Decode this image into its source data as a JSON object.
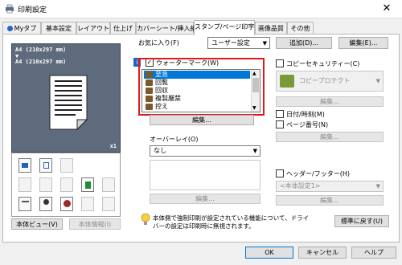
{
  "window": {
    "title": "印刷設定",
    "close_glyph": "✕"
  },
  "tabs": [
    {
      "label": "Myタブ",
      "icon": "mytab-icon"
    },
    {
      "label": "基本設定"
    },
    {
      "label": "レイアウト"
    },
    {
      "label": "仕上げ"
    },
    {
      "label": "カバーシート/挿入紙"
    },
    {
      "label": "スタンプ/ページ印字",
      "active": true
    },
    {
      "label": "画像品質"
    },
    {
      "label": "その他"
    }
  ],
  "favorites": {
    "label": "お気に入り(F)",
    "value": "ユーザー設定",
    "add_label": "追加(D)...",
    "edit_label": "編集(E)..."
  },
  "preview": {
    "paper_line1": "A4 (210x297 mm)",
    "arrow": "▼",
    "paper_line2": "A4 (210x297 mm)",
    "copies": "x1"
  },
  "left_buttons": {
    "view_label": "本体ビュー(V)",
    "info_label": "本体情報(I)"
  },
  "watermark": {
    "label": "ウォーターマーク(W)",
    "checked": true,
    "items": [
      "至急",
      "回覧",
      "回収",
      "複製厳禁",
      "控え"
    ],
    "selected_index": 0,
    "edit_label": "編集..."
  },
  "overlay": {
    "label": "オーバーレイ(O)",
    "value": "なし",
    "edit_label": "編集..."
  },
  "copy_security": {
    "label": "コピーセキュリティー(C)",
    "value": "コピープロテクト",
    "edit_label": "編集..."
  },
  "date_time": {
    "label": "日付/時刻(M)"
  },
  "page_number": {
    "label": "ページ番号(N)",
    "edit_label": "編集..."
  },
  "header_footer": {
    "label": "ヘッダー/フッター(H)",
    "value": "<本体設定1>",
    "edit_label": "編集..."
  },
  "notice": {
    "text_line1": "本体側で強制印刷が設定されている機能について、ドライ",
    "text_line2": "バーの設定は印刷時に無視されます。",
    "reset_label": "標準に戻す(U)"
  },
  "footer_buttons": {
    "ok": "OK",
    "cancel": "キャンセル",
    "help": "ヘルプ"
  },
  "colors": {
    "selection": "#0078d7",
    "highlight_box": "#e01a1a",
    "preview_bg": "#5d6b7c"
  }
}
